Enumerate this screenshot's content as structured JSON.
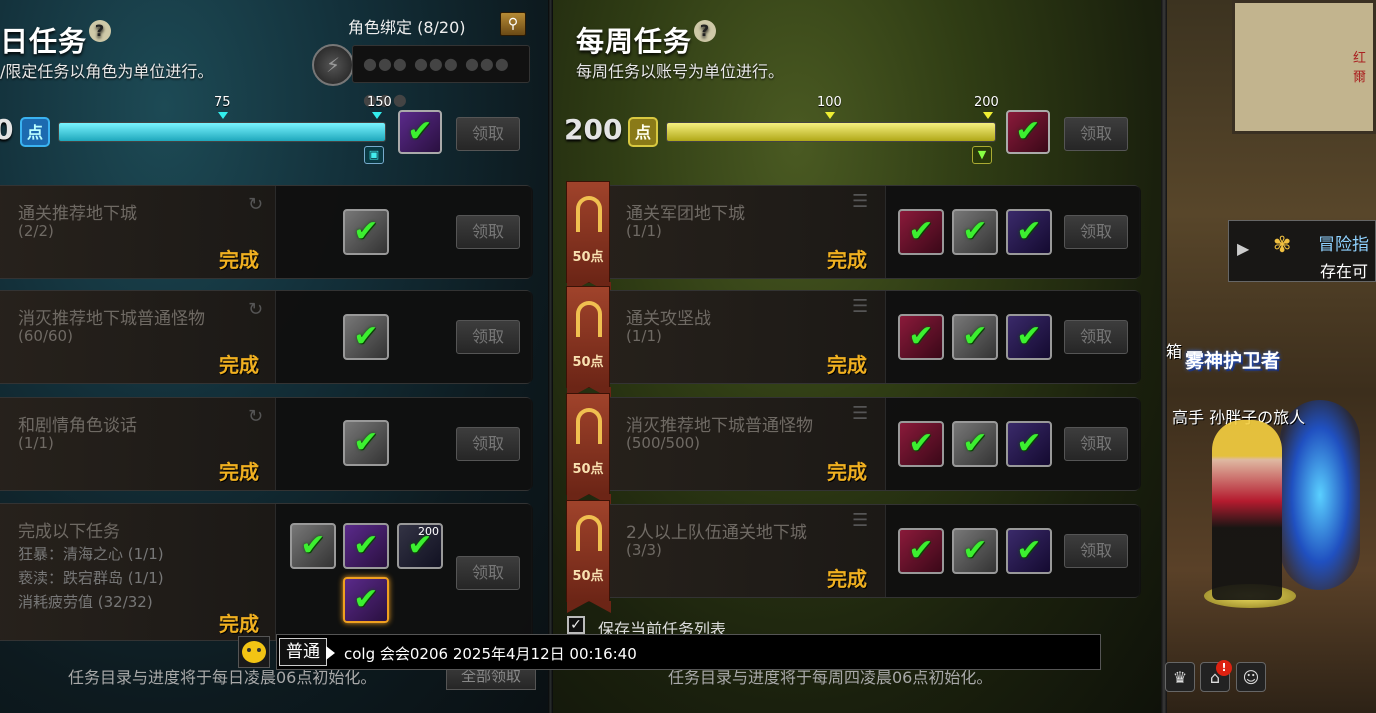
{
  "daily": {
    "title": "日任务",
    "help": "?",
    "subtitle": "/限定任务以角色为单位进行。",
    "bind_label": "角色绑定 (8/20)",
    "bind_input_placeholder": "●●● ●●● ●●● ●●●",
    "points_value": "0",
    "points_badge": "点",
    "progress_fraction": 1.0,
    "ticks": [
      "75",
      "150"
    ],
    "claim_label": "领取",
    "quests": [
      {
        "name": "通关推荐地下城",
        "progress": "(2/2)",
        "status": "完成",
        "claim": "领取"
      },
      {
        "name": "消灭推荐地下城普通怪物",
        "progress": "(60/60)",
        "status": "完成",
        "claim": "领取"
      },
      {
        "name": "和剧情角色谈话",
        "progress": "(1/1)",
        "status": "完成",
        "claim": "领取"
      },
      {
        "name": "完成以下任务",
        "subs": [
          "狂暴：清海之心 (1/1)",
          "亵渎：跌宕群岛 (1/1)",
          "消耗疲劳值 (32/32)"
        ],
        "status": "完成",
        "claim": "领取",
        "reward_count": "200"
      }
    ],
    "footer": "任务目录与进度将于每日凌晨06点初始化。",
    "claim_all": "全部领取"
  },
  "weekly": {
    "title": "每周任务",
    "help": "?",
    "subtitle": "每周任务以账号为单位进行。",
    "points_value": "200",
    "points_badge": "点",
    "progress_fraction": 1.0,
    "ticks": [
      "100",
      "200"
    ],
    "claim_label": "领取",
    "quests": [
      {
        "name": "通关军团地下城",
        "progress": "(1/1)",
        "status": "完成",
        "claim": "领取",
        "points": "50点"
      },
      {
        "name": "通关攻坚战",
        "progress": "(1/1)",
        "status": "完成",
        "claim": "领取",
        "points": "50点"
      },
      {
        "name": "消灭推荐地下城普通怪物",
        "progress": "(500/500)",
        "status": "完成",
        "claim": "领取",
        "points": "50点"
      },
      {
        "name": "2人以上队伍通关地下城",
        "progress": "(3/3)",
        "status": "完成",
        "claim": "领取",
        "points": "50点"
      }
    ],
    "save_list_label": "保存当前任务列表",
    "footer": "任务目录与进度将于每周四凌晨06点初始化。"
  },
  "chat": {
    "channel": "普通",
    "message": "colg 会会0206 2025年4月12日 00:16:40"
  },
  "scene": {
    "notice_title": "冒险指",
    "notice_sub": "存在可",
    "guild_name": "雾神护卫者",
    "player_name": "高手 孙胖子の旅人",
    "side_char": "箱",
    "map_label": "红爾",
    "hud_badge": "!"
  },
  "colors": {
    "daily_bar": "#2ec8d8",
    "weekly_bar": "#c8c030",
    "done_text": "#f0b020",
    "check_green": "#3cf030",
    "banner_red": "#a0432b"
  }
}
